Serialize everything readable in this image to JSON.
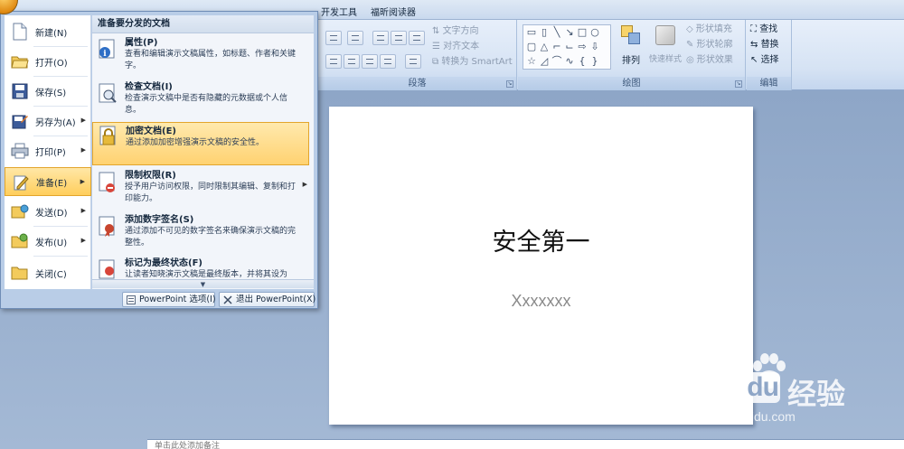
{
  "ribbon": {
    "tabs": [
      "开发工具",
      "福昕阅读器"
    ],
    "paragraph": {
      "label": "段落",
      "text_direction": "文字方向",
      "align_text": "对齐文本",
      "smartart": "转换为 SmartArt"
    },
    "drawing": {
      "label": "绘图",
      "arrange": "排列",
      "quick_styles": "快速样式",
      "shape_fill": "形状填充",
      "shape_outline": "形状轮廓",
      "shape_effects": "形状效果"
    },
    "editing": {
      "label": "编辑",
      "find": "查找",
      "replace": "替换",
      "select": "选择"
    }
  },
  "office_menu": {
    "items": [
      {
        "label": "新建(N)",
        "icon": "new-document-icon"
      },
      {
        "label": "打开(O)",
        "icon": "open-folder-icon"
      },
      {
        "label": "保存(S)",
        "icon": "save-disk-icon"
      },
      {
        "label": "另存为(A)",
        "icon": "save-as-icon"
      },
      {
        "label": "打印(P)",
        "icon": "printer-icon"
      },
      {
        "label": "准备(E)",
        "icon": "prepare-icon"
      },
      {
        "label": "发送(D)",
        "icon": "send-icon"
      },
      {
        "label": "发布(U)",
        "icon": "publish-icon"
      },
      {
        "label": "关闭(C)",
        "icon": "close-folder-icon"
      }
    ],
    "submenu": {
      "header": "准备要分发的文档",
      "items": [
        {
          "title": "属性(P)",
          "desc": "查看和编辑演示文稿属性，如标题、作者和关键字。"
        },
        {
          "title": "检查文档(I)",
          "desc": "检查演示文稿中是否有隐藏的元数据或个人信息。"
        },
        {
          "title": "加密文档(E)",
          "desc": "通过添加加密增强演示文稿的安全性。"
        },
        {
          "title": "限制权限(R)",
          "desc": "授予用户访问权限，同时限制其编辑、复制和打印能力。"
        },
        {
          "title": "添加数字签名(S)",
          "desc": "通过添加不可见的数字签名来确保演示文稿的完整性。"
        },
        {
          "title": "标记为最终状态(F)",
          "desc": "让读者知晓演示文稿是最终版本，并将其设为"
        }
      ]
    },
    "options_button": "PowerPoint 选项(I)",
    "exit_button": "退出 PowerPoint(X)"
  },
  "slide": {
    "title": "安全第一",
    "subtitle": "Xxxxxxx"
  },
  "notes": {
    "text": "单击此处添加备注"
  },
  "watermark": {
    "brand": "Bai",
    "brand_suffix": "du",
    "cn": "经验",
    "url": "jingyan.baidu.com"
  },
  "colors": {
    "accent": "#ffce5c",
    "ribbon": "#d6e3f4",
    "workspace": "#8ea6c7"
  }
}
